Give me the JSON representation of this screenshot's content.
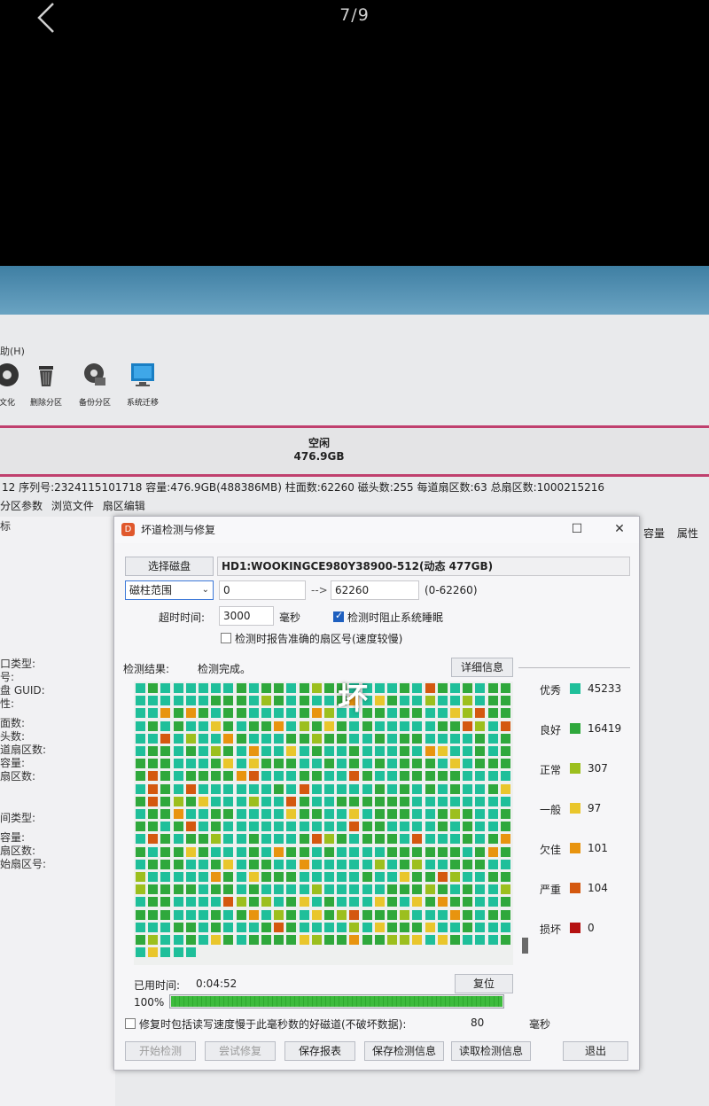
{
  "viewer": {
    "counter": "7/9"
  },
  "app": {
    "menu_help": "助(H)",
    "toolbar": [
      {
        "label": "文化",
        "icon": "disc-icon"
      },
      {
        "label": "删除分区",
        "icon": "trash-icon"
      },
      {
        "label": "备份分区",
        "icon": "backup-disc-icon"
      },
      {
        "label": "系统迁移",
        "icon": "migrate-monitor-icon"
      }
    ],
    "disk_bar": {
      "free_label": "空闲",
      "free_size": "476.9GB"
    },
    "disk_info": "12  序列号:2324115101718  容量:476.9GB(488386MB)  柱面数:62260  磁头数:255  每道扇区数:63  总扇区数:1000215216",
    "tabs": [
      "分区参数",
      "浏览文件",
      "扇区编辑"
    ],
    "left_panel": [
      "标",
      "口类型:",
      "号:",
      "盘 GUID:",
      "性:",
      "面数:",
      "头数:",
      "道扇区数:",
      "容量:",
      "扇区数:",
      "间类型:",
      "容量:",
      "扇区数:",
      "始扇区号:"
    ],
    "right_cols": [
      "容量",
      "属性"
    ]
  },
  "dialog": {
    "title": "坏道检测与修复",
    "select_disk_button": "选择磁盘",
    "disk_name": "HD1:WOOKINGCE980Y38900-512(动态 477GB)",
    "range_type": "磁柱范围",
    "range_start": "0",
    "range_arrow": "-->",
    "range_end": "62260",
    "range_hint": "(0-62260)",
    "timeout_label": "超时时间:",
    "timeout_value": "3000",
    "timeout_unit": "毫秒",
    "prevent_sleep_label": "检测时阻止系统睡眠",
    "prevent_sleep_checked": true,
    "report_sector_label": "检测时报告准确的扇区号(速度较慢)",
    "report_sector_checked": false,
    "result_label": "检测结果:",
    "result_status": "检测完成。",
    "detail_button": "详细信息",
    "overlay_char": "坏",
    "legend": [
      {
        "name": "优秀",
        "color": "#1fbf9a",
        "count": "45233"
      },
      {
        "name": "良好",
        "color": "#2fa83c",
        "count": "16419"
      },
      {
        "name": "正常",
        "color": "#9cbf1e",
        "count": "307"
      },
      {
        "name": "一般",
        "color": "#e9c62c",
        "count": "97"
      },
      {
        "name": "欠佳",
        "color": "#e8940f",
        "count": "101"
      },
      {
        "name": "严重",
        "color": "#d4580f",
        "count": "104"
      },
      {
        "name": "损坏",
        "color": "#b51111",
        "count": "0"
      }
    ],
    "elapsed_label": "已用时间:",
    "elapsed_value": "0:04:52",
    "reset_button": "复位",
    "progress_label": "100%",
    "progress_fraction": 1.0,
    "repair_label": "修复时包括读写速度慢于此毫秒数的好磁道(不破坏数据):",
    "repair_checked": false,
    "repair_value": "80",
    "repair_unit": "毫秒",
    "buttons": {
      "start": "开始检测",
      "try_repair": "尝试修复",
      "save_report": "保存报表",
      "save_info": "保存检测信息",
      "load_info": "读取检测信息",
      "exit": "退出"
    }
  }
}
